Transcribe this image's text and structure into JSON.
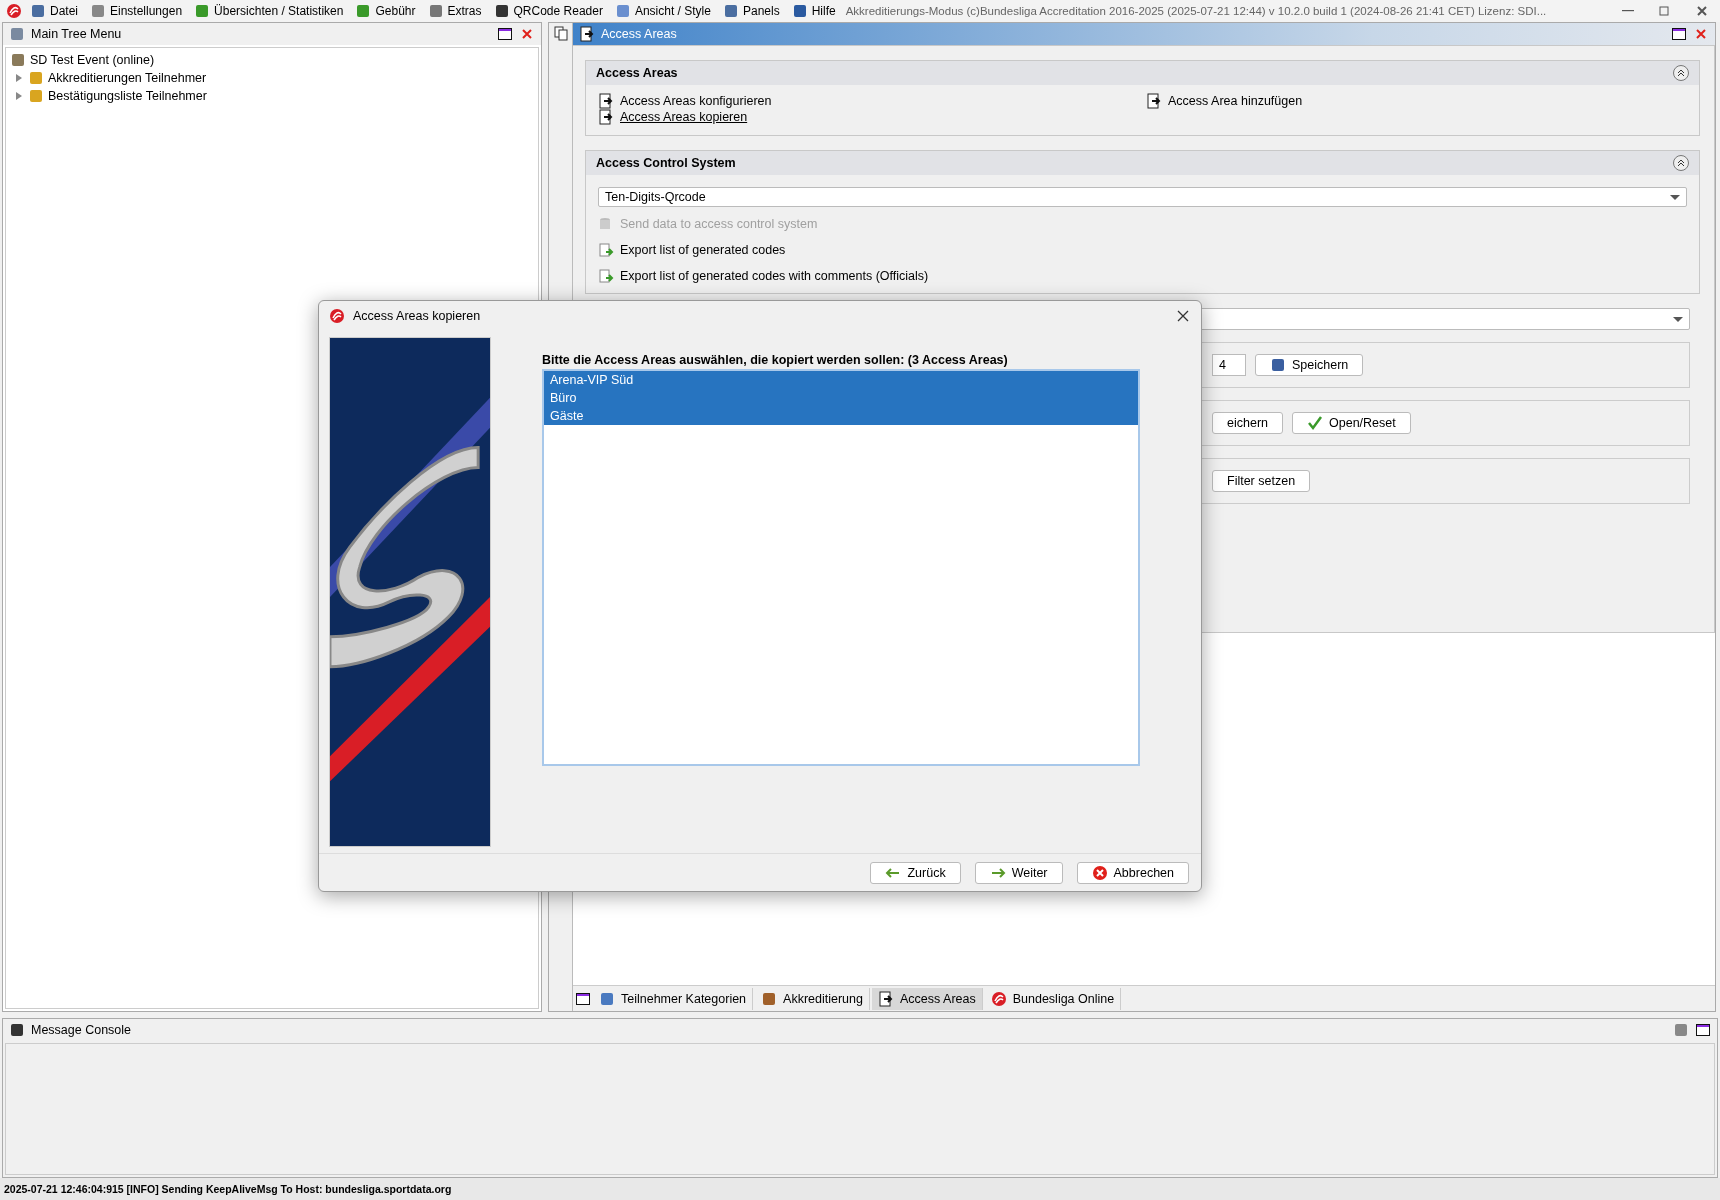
{
  "menu": [
    {
      "label": "Datei"
    },
    {
      "label": "Einstellungen"
    },
    {
      "label": "Übersichten / Statistiken"
    },
    {
      "label": "Gebühr"
    },
    {
      "label": "Extras"
    },
    {
      "label": "QRCode Reader"
    },
    {
      "label": "Ansicht / Style"
    },
    {
      "label": "Panels"
    },
    {
      "label": "Hilfe"
    }
  ],
  "window": {
    "title": "Akkreditierungs-Modus (c)Bundesliga Accreditation 2016-2025 (2025-07-21 12:44) v 10.2.0 build 1 (2024-08-26 21:41 CET) Lizenz: SDI..."
  },
  "tree_panel": {
    "title": "Main Tree Menu",
    "items": [
      {
        "label": "SD Test Event (online)",
        "children": [
          {
            "label": "Akkreditierungen Teilnehmer",
            "expanded": false
          },
          {
            "label": "Bestätigungsliste Teilnehmer",
            "expanded": false
          }
        ]
      }
    ]
  },
  "access_panel": {
    "title": "Access Areas",
    "sections": [
      {
        "title": "Access Areas",
        "expanded": true,
        "links": [
          [
            {
              "label": "Access Areas konfigurieren",
              "underlined": false
            },
            {
              "label": "Access Areas kopieren",
              "underlined": true
            }
          ],
          [
            {
              "label": "Access Area hinzufügen",
              "underlined": false
            }
          ]
        ]
      },
      {
        "title": "Access Control System",
        "expanded": true,
        "dropdown": "Ten-Digits-Qrcode",
        "actions": [
          {
            "label": "Send data to access control system",
            "disabled": true
          },
          {
            "label": "Export list of generated codes",
            "disabled": false
          },
          {
            "label": "Export list of generated codes with comments (Officials)",
            "disabled": false
          }
        ]
      }
    ],
    "partial": {
      "field_value": "4",
      "button_rows": [
        [
          {
            "label": "Speichern"
          }
        ],
        [
          {
            "label": "eichern"
          },
          {
            "label": "Open/Reset"
          }
        ],
        [
          {
            "label": "Filter setzen"
          }
        ]
      ]
    },
    "tabs": [
      {
        "label": "Teilnehmer Kategorien",
        "selected": false
      },
      {
        "label": "Akkreditierung",
        "selected": false
      },
      {
        "label": "Access Areas",
        "selected": true
      },
      {
        "label": "Bundesliga Online",
        "selected": false
      }
    ]
  },
  "console": {
    "title": "Message Console"
  },
  "status_bar": "2025-07-21 12:46:04:915 [INFO] Sending KeepAliveMsg To Host: bundesliga.sportdata.org",
  "dialog": {
    "title": "Access Areas kopieren",
    "prompt": "Bitte die Access Areas auswählen, die kopiert werden sollen: (3 Access Areas)",
    "items": [
      {
        "label": "Arena-VIP Süd",
        "selected": true
      },
      {
        "label": "Büro",
        "selected": true
      },
      {
        "label": "Gäste",
        "selected": true
      }
    ],
    "buttons": [
      {
        "label": "Zurück",
        "kind": "back"
      },
      {
        "label": "Weiter",
        "kind": "next"
      },
      {
        "label": "Abbrechen",
        "kind": "cancel"
      }
    ]
  }
}
